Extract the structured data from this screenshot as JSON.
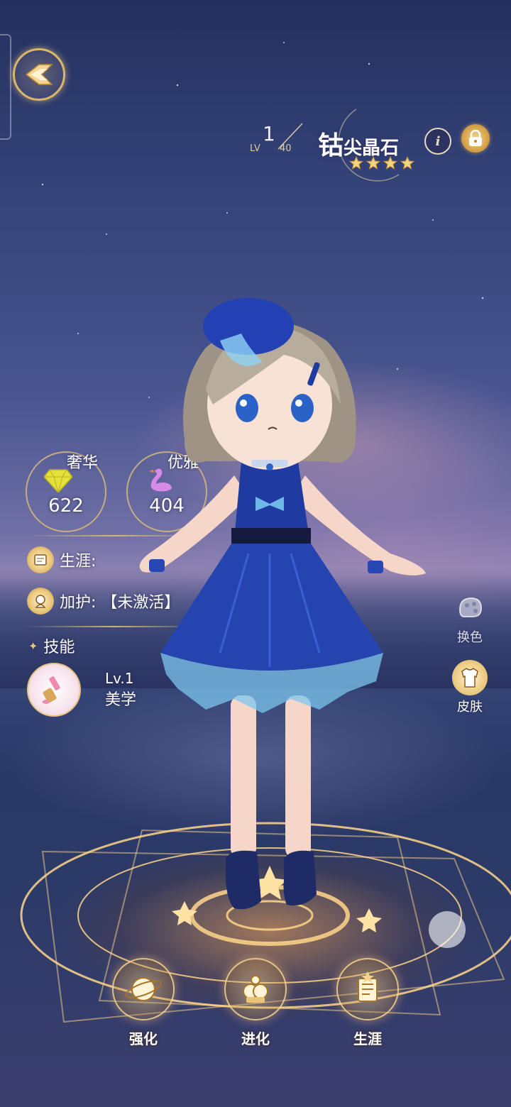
{
  "header": {
    "level_current": "1",
    "level_prefix": "LV",
    "level_max": "40",
    "name_main": "钴",
    "name_rest": "尖晶石",
    "star_count": 4,
    "info_glyph": "i"
  },
  "stats": [
    {
      "label": "奢华",
      "value": "622",
      "icon": "diamond-icon"
    },
    {
      "label": "优雅",
      "value": "404",
      "icon": "swan-icon"
    }
  ],
  "rows": {
    "career_label": "生涯:",
    "protect_label": "加护:",
    "protect_value": "【未激活】",
    "skill_header": "技能"
  },
  "skill": {
    "level": "Lv.1",
    "name": "美学",
    "icon": "paintbrush-icon"
  },
  "side_buttons": [
    {
      "label": "换色",
      "icon": "dye-icon"
    },
    {
      "label": "皮肤",
      "icon": "skin-icon"
    }
  ],
  "bottom_nav": [
    {
      "label": "强化",
      "icon": "enhance-icon"
    },
    {
      "label": "进化",
      "icon": "evolve-icon"
    },
    {
      "label": "生涯",
      "icon": "career-icon"
    }
  ],
  "colors": {
    "gold": "#d8b66a",
    "dress": "#1f3aa0",
    "sky": "#35447a"
  }
}
